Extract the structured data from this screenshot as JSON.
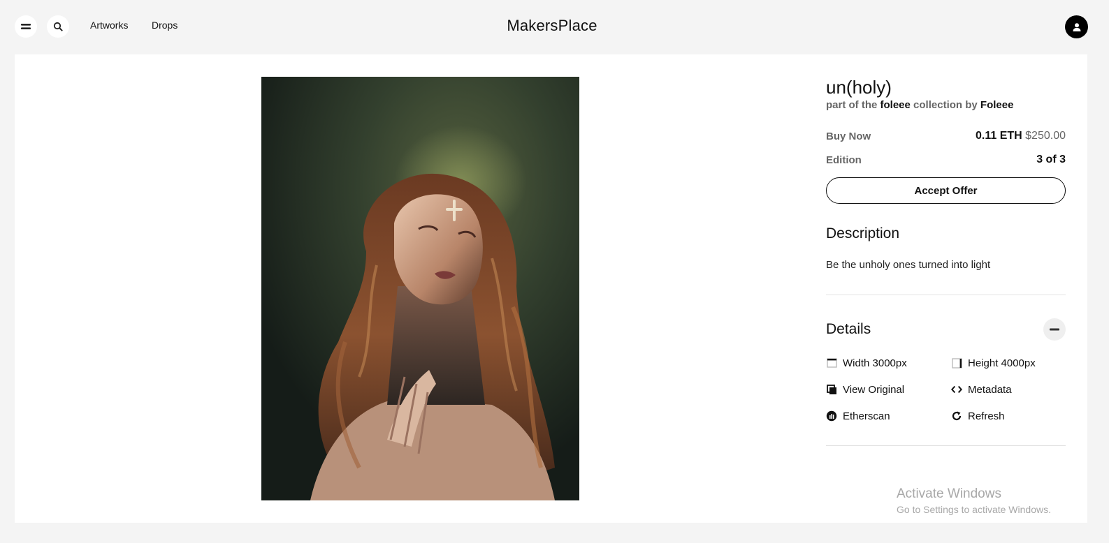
{
  "header": {
    "logo": "MakersPlace",
    "nav": [
      {
        "label": "Artworks"
      },
      {
        "label": "Drops"
      }
    ]
  },
  "artwork": {
    "title": "un(holy)",
    "subtitle_prefix": "part of the",
    "collection": "foleee",
    "subtitle_middle": "collection by",
    "creator": "Foleee",
    "buy_now_label": "Buy Now",
    "price_eth": "0.11 ETH",
    "price_usd": "$250.00",
    "edition_label": "Edition",
    "edition_value": "3 of 3",
    "accept_offer_label": "Accept Offer"
  },
  "description": {
    "heading": "Description",
    "text": "Be the unholy ones turned into light"
  },
  "details": {
    "heading": "Details",
    "items": [
      {
        "label": "Width 3000px",
        "icon": "width-icon"
      },
      {
        "label": "Height 4000px",
        "icon": "height-icon"
      },
      {
        "label": "View Original",
        "icon": "view-original-icon"
      },
      {
        "label": "Metadata",
        "icon": "code-icon"
      },
      {
        "label": "Etherscan",
        "icon": "etherscan-icon"
      },
      {
        "label": "Refresh",
        "icon": "refresh-icon"
      }
    ]
  },
  "windows_watermark": {
    "title": "Activate Windows",
    "subtitle": "Go to Settings to activate Windows."
  },
  "colors": {
    "background": "#f4f4f4",
    "card": "#ffffff",
    "text": "#111111",
    "muted": "#666666"
  }
}
